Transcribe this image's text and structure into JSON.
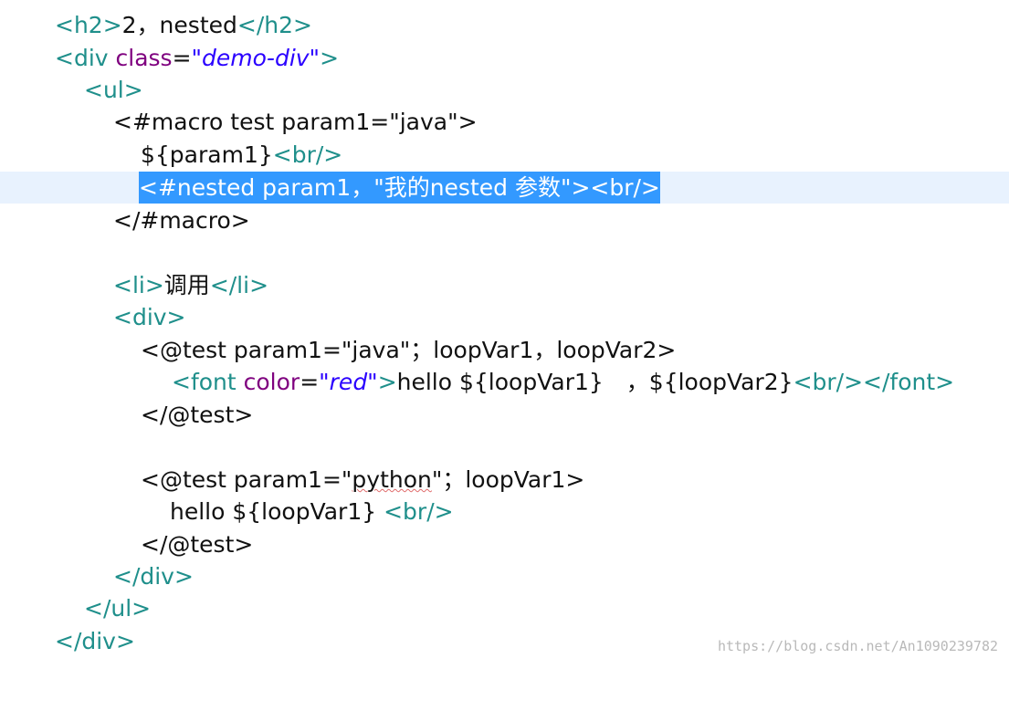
{
  "code": {
    "line01": {
      "t1": "<h2>",
      "t2": "2，nested",
      "t3": "</h2>"
    },
    "line02": {
      "t1": "<div ",
      "a1": "class",
      "eq": "=",
      "v1": "\"demo-div\"",
      "t2": ">"
    },
    "line03": {
      "t1": "<ul>"
    },
    "line04": {
      "t1": "<#macro test param1=\"java\">"
    },
    "line05": {
      "t1": "${param1}",
      "t2": "<br/>"
    },
    "line06": {
      "t1": "<#nested param1，\"我的nested 参数\"><br/>"
    },
    "line07": {
      "t1": "</#macro>"
    },
    "line09": {
      "t1": "<li>",
      "t2": "调用",
      "t3": "</li>"
    },
    "line10": {
      "t1": "<div>"
    },
    "line11": {
      "t1": "<@test param1=\"java\"；loopVar1，loopVar2>"
    },
    "line12": {
      "t1": "<font ",
      "a1": "color",
      "eq": "=",
      "v1": "\"red\"",
      "t2": ">",
      "t3": "hello ${loopVar1}　，${loopVar2}",
      "t4": "<br/></font>"
    },
    "line13": {
      "t1": "</@test>"
    },
    "line15": {
      "t1": "<@test param1=\"",
      "t2": "python",
      "t3": "\"；loopVar1>"
    },
    "line16": {
      "t1": "hello ${loopVar1} ",
      "t2": "<br/>"
    },
    "line17": {
      "t1": "</@test>"
    },
    "line18": {
      "t1": "</div>"
    },
    "line19": {
      "t1": "</ul>"
    },
    "line20": {
      "t1": "</div>"
    }
  },
  "watermark": "https://blog.csdn.net/An1090239782",
  "colors": {
    "tag": "#1f8f8b",
    "attribute": "#7f007f",
    "value": "#2a00ff",
    "selection": "#3399ff",
    "current_line": "#e8f2fe"
  }
}
